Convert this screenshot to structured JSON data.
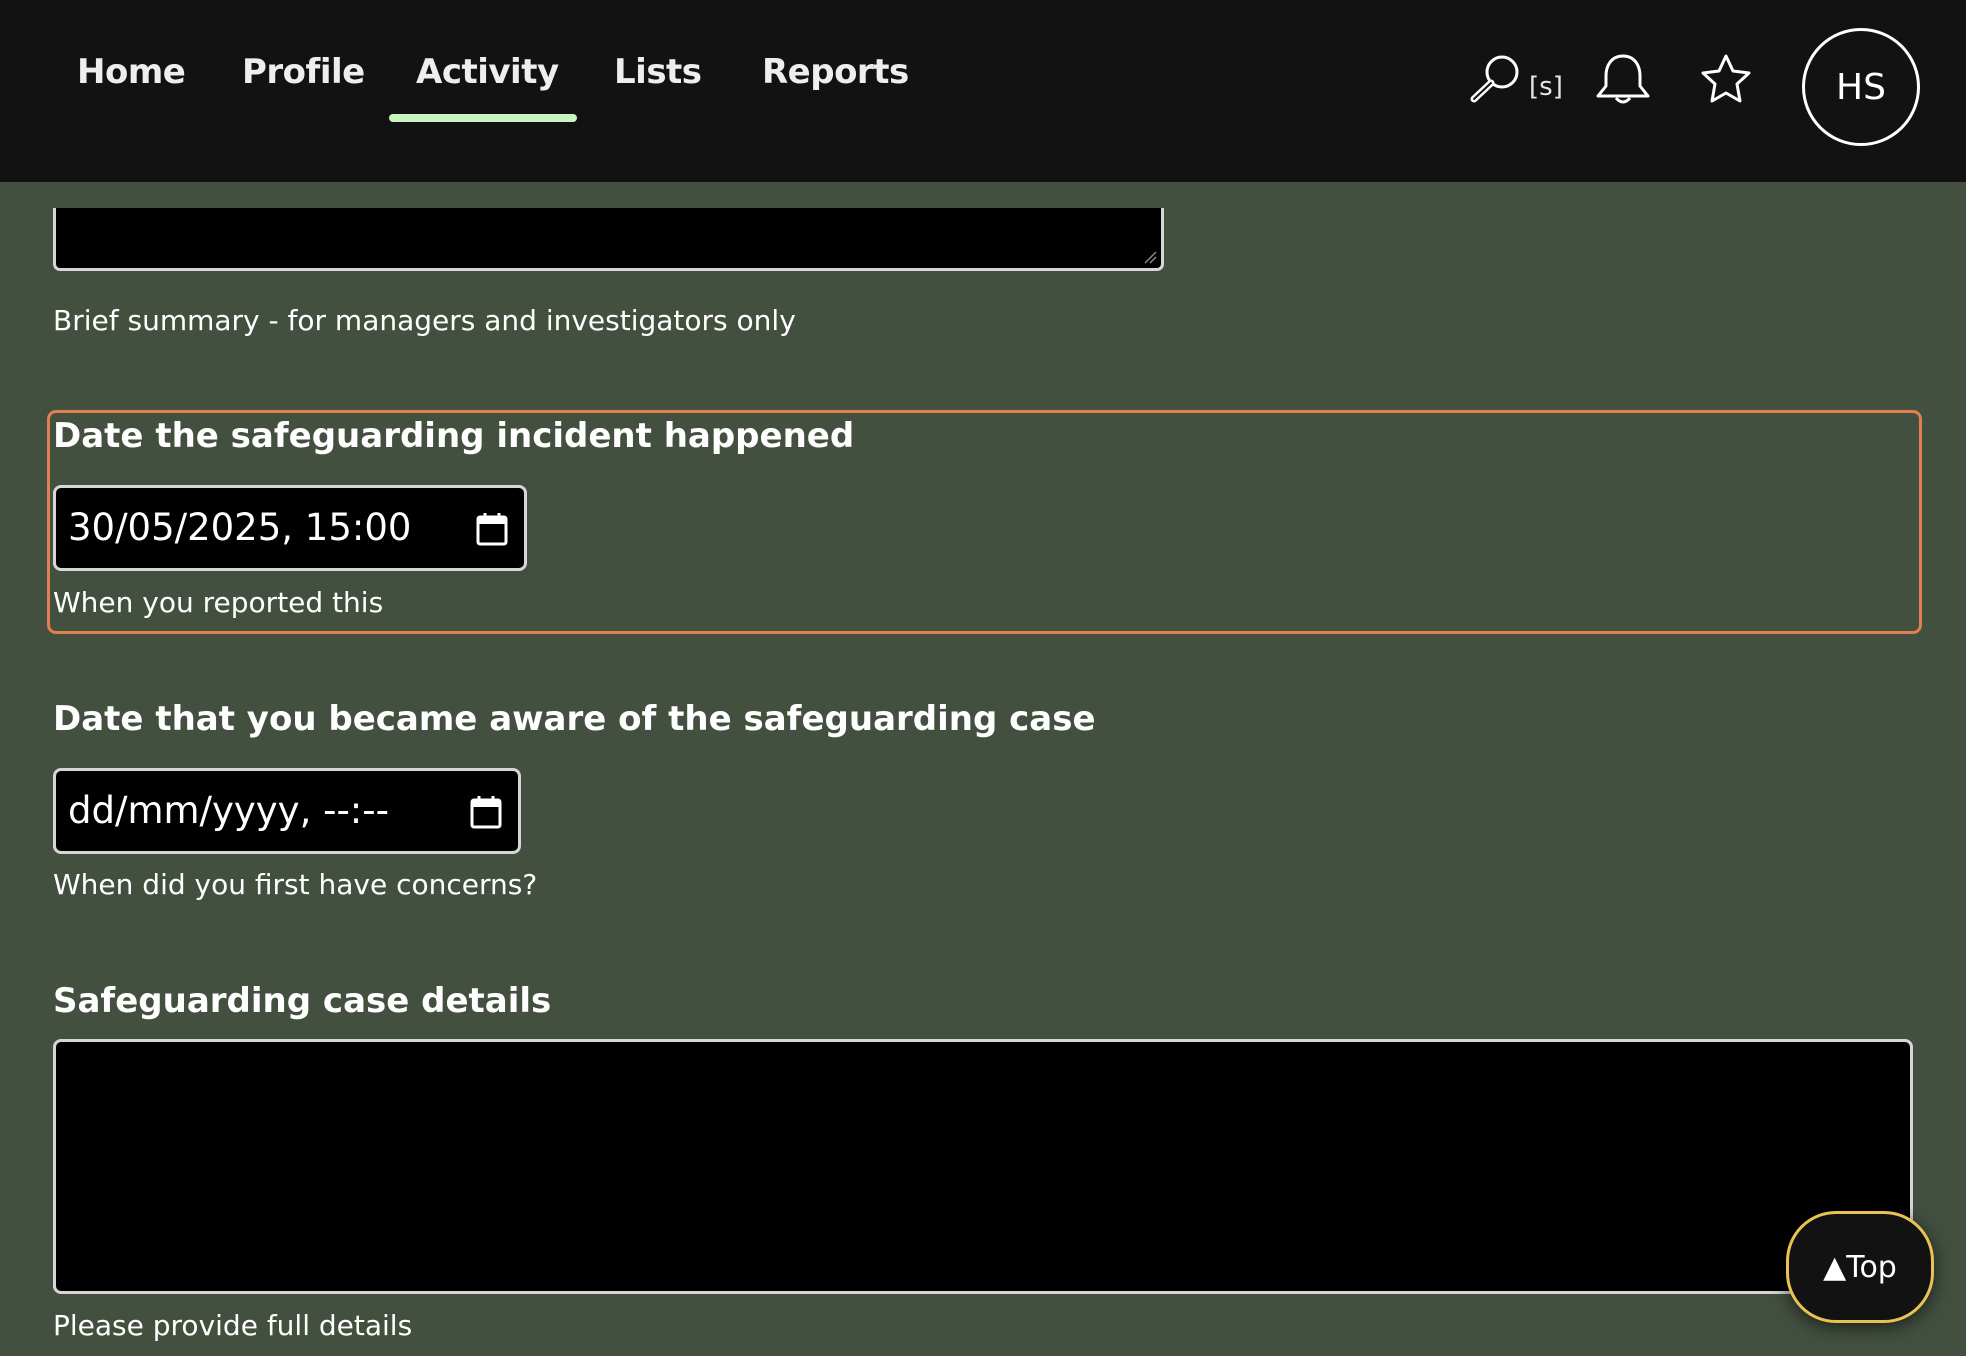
{
  "nav": {
    "items": [
      {
        "label": "Home"
      },
      {
        "label": "Profile"
      },
      {
        "label": "Activity"
      },
      {
        "label": "Lists"
      },
      {
        "label": "Reports"
      }
    ],
    "active": "Activity",
    "search_hint": "[s]",
    "icons": [
      "search-icon",
      "bell-icon",
      "star-icon"
    ],
    "avatar_initials": "HS"
  },
  "form": {
    "summary_help": "Brief summary - for managers and investigators only",
    "incident_date": {
      "label": "Date the safeguarding incident happened",
      "value": "30/05/2025, 15:00",
      "help": "When you reported this"
    },
    "aware_date": {
      "label": "Date that you became aware of the safeguarding case",
      "value": "dd/mm/yyyy, --:--",
      "help": "When did you first have concerns?"
    },
    "case_details": {
      "label": "Safeguarding case details",
      "help": "Please provide full details"
    }
  },
  "top_button": {
    "label": "▲Top"
  },
  "colors": {
    "page_bg": "#435040",
    "header_bg": "#121212",
    "active_underline": "#c8f5bd",
    "highlight_border": "#e0804e",
    "top_button_border": "#e9c253"
  }
}
